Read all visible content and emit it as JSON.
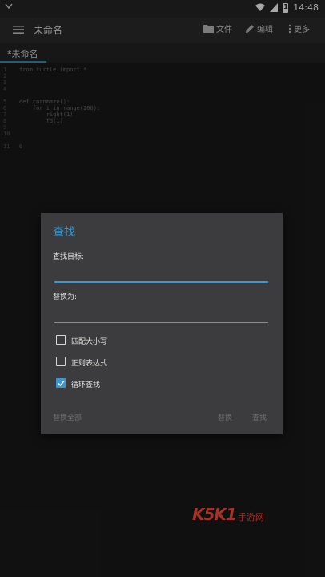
{
  "status_bar": {
    "time": "14:48",
    "battery": "1"
  },
  "app_bar": {
    "title": "未命名",
    "actions": [
      {
        "label": "文件",
        "icon": "folder-icon"
      },
      {
        "label": "编辑",
        "icon": "pencil-icon"
      },
      {
        "label": "更多",
        "icon": "more-vert-icon"
      }
    ]
  },
  "tabs": [
    {
      "label": "*未命名",
      "active": true
    }
  ],
  "editor": {
    "line_numbers": [
      "1",
      "2",
      "3",
      "4",
      "5",
      "6",
      "7",
      "8",
      "9",
      "10",
      "11"
    ],
    "lines": [
      "from turtle import *",
      "",
      "",
      "",
      "def cornmaze():",
      "    for i in range(200):",
      "        right(1)",
      "        fd(1)",
      "",
      "",
      "0"
    ]
  },
  "find_dialog": {
    "title": "查找",
    "find_label": "查找目标:",
    "find_value": "",
    "replace_label": "替换为:",
    "replace_value": "",
    "options": [
      {
        "label": "匹配大小写",
        "checked": false
      },
      {
        "label": "正则表达式",
        "checked": false
      },
      {
        "label": "循环查找",
        "checked": true
      }
    ],
    "buttons": {
      "replace_all": "替换全部",
      "replace": "替换",
      "find": "查找"
    }
  },
  "watermark": {
    "brand": "K5K1",
    "text": "手游网"
  },
  "colors": {
    "accent": "#3a97cf",
    "dialog_bg": "#3c3c3e",
    "editor_bg": "#1a1a1b"
  }
}
